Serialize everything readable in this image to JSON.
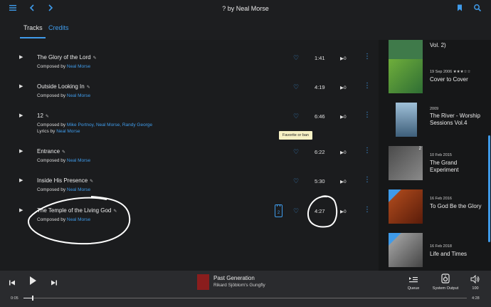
{
  "header": {
    "title": "? by Neal Morse",
    "menu_icon": "menu-icon",
    "back_icon": "chevron-left-icon",
    "forward_icon": "chevron-right-icon",
    "bookmark_icon": "bookmark-icon",
    "search_icon": "search-icon"
  },
  "tabs": [
    {
      "label": "Tracks",
      "active": true
    },
    {
      "label": "Credits",
      "active": false
    }
  ],
  "tracks": [
    {
      "title": "The Glory of the Lord",
      "credit_lines": [
        {
          "prefix": "Composed by",
          "names": "Neal Morse"
        }
      ],
      "duration": "1:41",
      "plays": "0"
    },
    {
      "title": "Outside Looking In",
      "credit_lines": [
        {
          "prefix": "Composed by",
          "names": "Neal Morse"
        }
      ],
      "duration": "4:19",
      "plays": "0"
    },
    {
      "title": "12",
      "credit_lines": [
        {
          "prefix": "Composed by",
          "names": "Mike Portnoy, Neal Morse, Randy George"
        },
        {
          "prefix": "Lyrics by",
          "names": "Neal Morse"
        }
      ],
      "duration": "6:46",
      "plays": "0"
    },
    {
      "title": "Entrance",
      "credit_lines": [
        {
          "prefix": "Composed by",
          "names": "Neal Morse"
        }
      ],
      "duration": "6:22",
      "plays": "0"
    },
    {
      "title": "Inside His Presence",
      "credit_lines": [
        {
          "prefix": "Composed by",
          "names": "Neal Morse"
        }
      ],
      "duration": "5:30",
      "plays": "0"
    },
    {
      "title": "The Temple of the Living God",
      "credit_lines": [
        {
          "prefix": "Composed by",
          "names": "Neal Morse"
        }
      ],
      "duration": "4:27",
      "plays": "0",
      "disc": "2"
    }
  ],
  "tooltip": "Favorite or ban",
  "albums": [
    {
      "date": "",
      "title": "Vol. 2)",
      "cover_color": "#3f7a4a"
    },
    {
      "date": "19 Sep 2006 ★★★☆☆",
      "title": "Cover to Cover",
      "cover_color": "#2f6e34"
    },
    {
      "date": "2009",
      "title": "The River - Worship Sessions Vol.4",
      "cover_color": "#6f8fa8"
    },
    {
      "date": "10 Feb 2015",
      "title": "The Grand Experiment",
      "cover_color": "#5a5a5a",
      "badge": "2"
    },
    {
      "date": "16 Feb 2016",
      "title": "To God Be the Glory",
      "cover_color": "#8a3a14"
    },
    {
      "date": "16 Feb 2018",
      "title": "Life and Times",
      "cover_color": "#6e6e6e"
    }
  ],
  "player": {
    "track": "Past Generation",
    "artist": "Rikard Sjöblom's Gungfly",
    "elapsed": "0:05",
    "total": "4:28",
    "progress_fraction": 0.02,
    "queue_label": "Queue",
    "output_label": "System Output",
    "volume": "100"
  }
}
